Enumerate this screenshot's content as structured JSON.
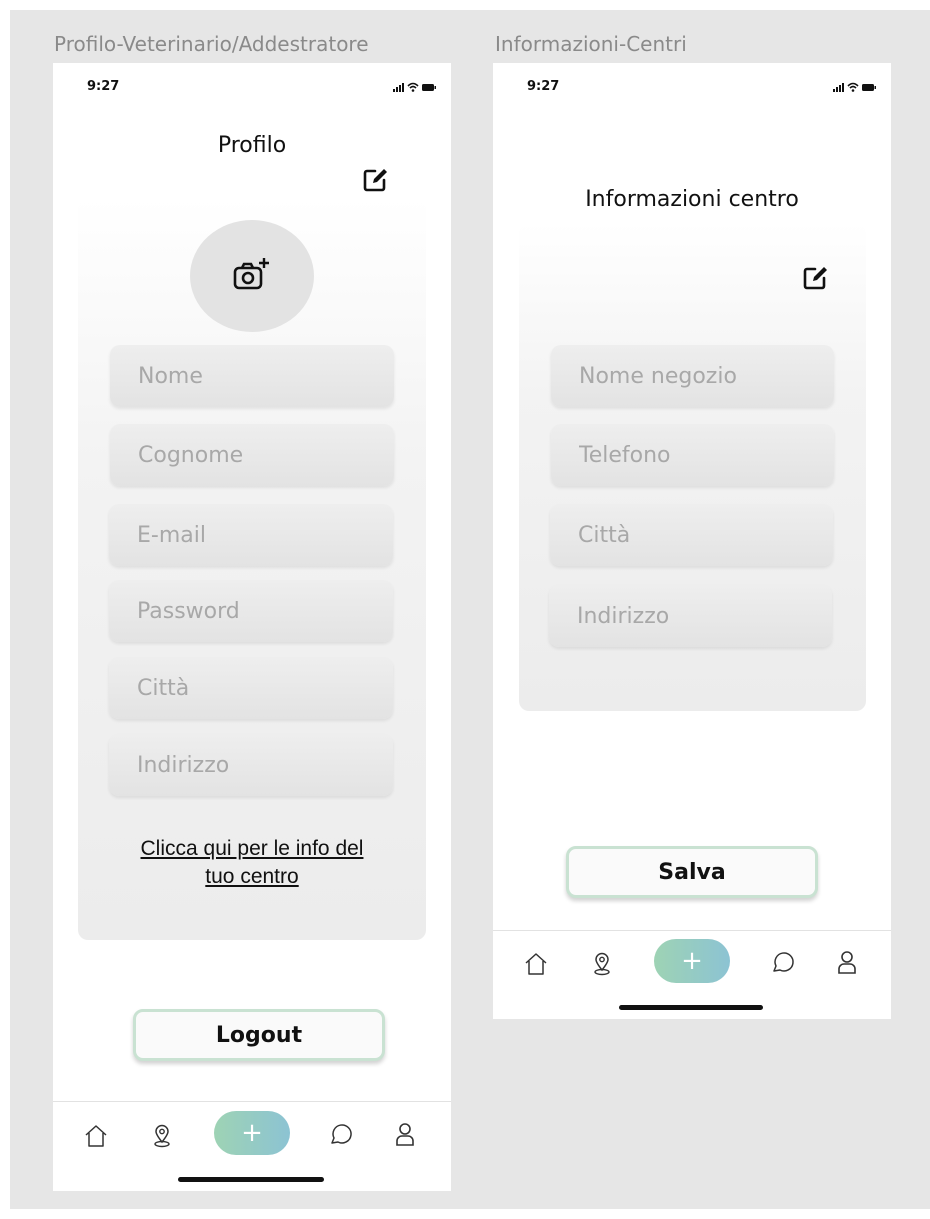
{
  "frames": {
    "left_label": "Profilo-Veterinario/Addestratore",
    "right_label": "Informazioni-Centri"
  },
  "profile_screen": {
    "status_time": "9:27",
    "title": "Profilo",
    "fields": [
      {
        "placeholder": "Nome"
      },
      {
        "placeholder": "Cognome"
      },
      {
        "placeholder": "E-mail"
      },
      {
        "placeholder": "Password"
      },
      {
        "placeholder": "Città"
      },
      {
        "placeholder": "Indirizzo"
      }
    ],
    "center_link_line1": "Clicca qui per le info del",
    "center_link_line2": "tuo centro",
    "logout_label": "Logout"
  },
  "center_screen": {
    "status_time": "9:27",
    "title": "Informazioni centro",
    "fields": [
      {
        "placeholder": "Nome negozio"
      },
      {
        "placeholder": "Telefono"
      },
      {
        "placeholder": "Città"
      },
      {
        "placeholder": "Indirizzo"
      }
    ],
    "save_label": "Salva"
  },
  "tabbar": {
    "plus_label": "+",
    "icons": [
      "home-icon",
      "map-pin-icon",
      "plus-icon",
      "chat-icon",
      "user-icon"
    ]
  },
  "colors": {
    "canvas": "#e6e6e6",
    "accent_gradient_start": "#9ed3b4",
    "accent_gradient_end": "#8cc3d3",
    "button_border": "#c9e2d2"
  }
}
